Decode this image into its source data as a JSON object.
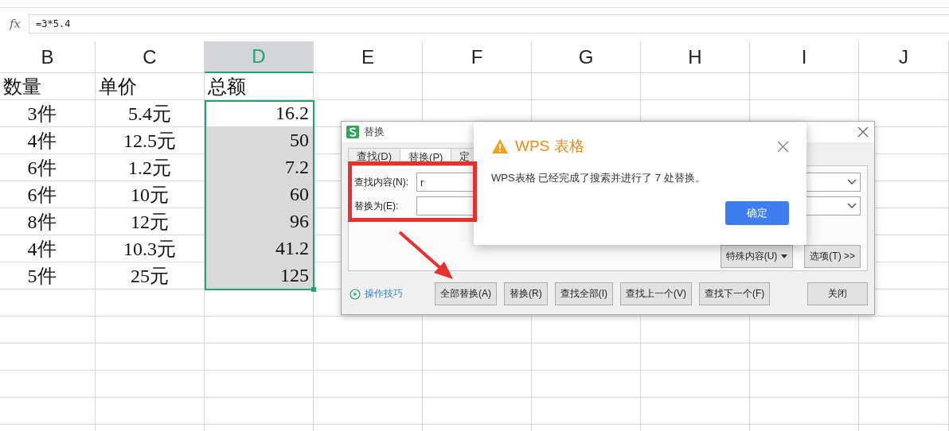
{
  "formula_bar": {
    "function_label": "fx",
    "formula": "=3*5.4"
  },
  "columns": [
    {
      "label": "B",
      "selected": false
    },
    {
      "label": "C",
      "selected": false
    },
    {
      "label": "D",
      "selected": true
    },
    {
      "label": "E",
      "selected": false
    },
    {
      "label": "F",
      "selected": false
    },
    {
      "label": "G",
      "selected": false
    },
    {
      "label": "H",
      "selected": false
    },
    {
      "label": "I",
      "selected": false
    },
    {
      "label": "J",
      "selected": false
    }
  ],
  "header_row": [
    "数量",
    "单价",
    "总额"
  ],
  "rows": [
    {
      "quantity": "3件",
      "price": "5.4元",
      "total": "16.2",
      "selected": true,
      "active": true
    },
    {
      "quantity": "4件",
      "price": "12.5元",
      "total": "50",
      "selected": true,
      "active": false
    },
    {
      "quantity": "6件",
      "price": "1.2元",
      "total": "7.2",
      "selected": true,
      "active": false
    },
    {
      "quantity": "6件",
      "price": "10元",
      "total": "60",
      "selected": true,
      "active": false
    },
    {
      "quantity": "8件",
      "price": "12元",
      "total": "96",
      "selected": true,
      "active": false
    },
    {
      "quantity": "4件",
      "price": "10.3元",
      "total": "41.2",
      "selected": true,
      "active": false
    },
    {
      "quantity": "5件",
      "price": "25元",
      "total": "125",
      "selected": true,
      "active": false
    }
  ],
  "replace_dialog": {
    "title": "替换",
    "tabs": [
      {
        "label": "查找(D)",
        "selected": false
      },
      {
        "label": "替换(P)",
        "selected": true
      },
      {
        "label": "定",
        "selected": false
      }
    ],
    "find_label": "查找内容(N):",
    "find_value": "r",
    "replace_label": "替换为(E):",
    "special_button": "特殊内容(U)",
    "options_button": "选项(T) >>",
    "tips_link": "操作技巧",
    "buttons": [
      "全部替换(A)",
      "替换(R)",
      "查找全部(I)",
      "查找上一个(V)",
      "查找下一个(F)"
    ],
    "close_button": "关闭"
  },
  "alert": {
    "title": "WPS 表格",
    "message": "WPS表格 已经完成了搜索并进行了 7 处替换。",
    "ok_button": "确定"
  }
}
